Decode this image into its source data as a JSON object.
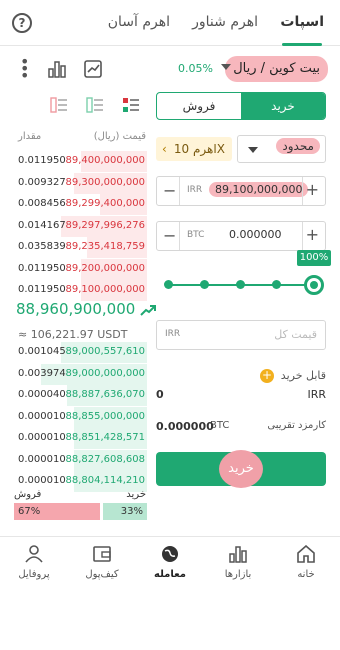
{
  "tabs": {
    "spot": "اسپات",
    "floating": "اهرم شناور",
    "easy": "اهرم آسان"
  },
  "pair": {
    "name": "بیت کوین / ریال",
    "change": "0.05%"
  },
  "orderbook": {
    "price_header": "قیمت (ریال)",
    "amount_header": "مقدار",
    "asks": [
      {
        "q": "0.011950",
        "p": "89,400,000,000"
      },
      {
        "q": "0.009327",
        "p": "89,300,000,000"
      },
      {
        "q": "0.008456",
        "p": "89,299,400,000"
      },
      {
        "q": "0.014167",
        "p": "89,297,996,276"
      },
      {
        "q": "0.035839",
        "p": "89,235,418,759"
      },
      {
        "q": "0.011950",
        "p": "89,200,000,000"
      },
      {
        "q": "0.011950",
        "p": "89,100,000,000"
      }
    ],
    "last_price": "88,960,900,000",
    "usdt": "≈ 106,221.97 USDT",
    "bids": [
      {
        "q": "0.001045",
        "p": "89,000,557,610"
      },
      {
        "q": "0.003974",
        "p": "89,000,000,000"
      },
      {
        "q": "0.000040",
        "p": "88,887,636,070"
      },
      {
        "q": "0.000010",
        "p": "88,855,000,000"
      },
      {
        "q": "0.000010",
        "p": "88,851,428,571"
      },
      {
        "q": "0.000010",
        "p": "88,827,608,608"
      },
      {
        "q": "0.000010",
        "p": "88,804,114,210"
      }
    ],
    "buy_label": "خرید",
    "sell_label": "فروش",
    "buy_pct": "33%",
    "sell_pct": "67%"
  },
  "form": {
    "buy": "خرید",
    "sell": "فروش",
    "order_type": "محدود",
    "leverage": "اهرم 10X",
    "price_unit": "IRR",
    "price_value": "89,100,000,000",
    "amount_unit": "BTC",
    "amount_value": "0.000000",
    "slider_label": "100%",
    "total_placeholder": "قیمت کل",
    "total_unit": "IRR",
    "available_label": "قابل خرید",
    "available_unit": "IRR",
    "available_value": "0",
    "fee_label": "کارمزد تقریبی",
    "fee_unit": "BTC",
    "fee_value": "0.000000",
    "submit": "خرید"
  },
  "nav": {
    "home": "خانه",
    "markets": "بازارها",
    "trade": "معامله",
    "wallet": "کیف‌پول",
    "profile": "پروفایل"
  },
  "colors": {
    "green": "#1fa872",
    "red": "#d9363e",
    "highlight": "#f7b7bd"
  }
}
